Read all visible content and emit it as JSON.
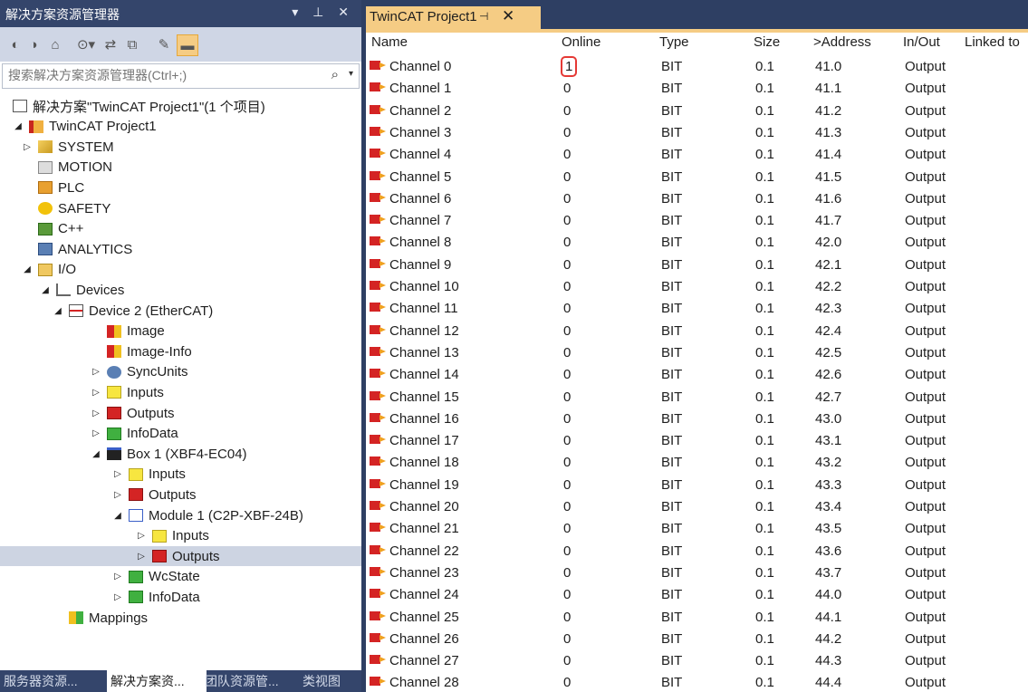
{
  "left_panel": {
    "title": "解决方案资源管理器",
    "title_buttons": "▾ ⊥ ✕",
    "search": {
      "placeholder": "搜索解决方案资源管理器(Ctrl+;)",
      "value": ""
    },
    "tree": [
      {
        "label": "解决方案\"TwinCAT Project1\"(1 个项目)",
        "icon": "solution-icon",
        "level": 0,
        "arrow": ""
      },
      {
        "label": "TwinCAT Project1",
        "icon": "project-icon",
        "level": 1,
        "arrow": "◢"
      },
      {
        "label": "SYSTEM",
        "icon": "system-icon",
        "level": 2,
        "arrow": "▷"
      },
      {
        "label": "MOTION",
        "icon": "motion-icon",
        "level": 2,
        "arrow": ""
      },
      {
        "label": "PLC",
        "icon": "plc-icon",
        "level": 2,
        "arrow": ""
      },
      {
        "label": "SAFETY",
        "icon": "safety-icon",
        "level": 2,
        "arrow": ""
      },
      {
        "label": "C++",
        "icon": "cpp-icon",
        "level": 2,
        "arrow": ""
      },
      {
        "label": "ANALYTICS",
        "icon": "analytics-icon",
        "level": 2,
        "arrow": ""
      },
      {
        "label": "I/O",
        "icon": "io-icon",
        "level": 2,
        "arrow": "◢"
      },
      {
        "label": "Devices",
        "icon": "devices-icon",
        "level": 3,
        "arrow": "◢"
      },
      {
        "label": "Device 2 (EtherCAT)",
        "icon": "ethercat-device-icon",
        "level": 4,
        "arrow": "◢"
      },
      {
        "label": "Image",
        "icon": "image-icon",
        "level": 5,
        "arrow": ""
      },
      {
        "label": "Image-Info",
        "icon": "image-info-icon",
        "level": 5,
        "arrow": ""
      },
      {
        "label": "SyncUnits",
        "icon": "syncunits-icon",
        "level": 5,
        "arrow": "▷"
      },
      {
        "label": "Inputs",
        "icon": "inputs-icon",
        "level": 5,
        "arrow": "▷"
      },
      {
        "label": "Outputs",
        "icon": "outputs-icon",
        "level": 5,
        "arrow": "▷"
      },
      {
        "label": "InfoData",
        "icon": "infodata-icon",
        "level": 5,
        "arrow": "▷"
      },
      {
        "label": "Box 1 (XBF4-EC04)",
        "icon": "box-icon",
        "level": 5,
        "arrow": "◢"
      },
      {
        "label": "Inputs",
        "icon": "inputs-icon",
        "level": 6,
        "arrow": "▷"
      },
      {
        "label": "Outputs",
        "icon": "outputs-icon",
        "level": 6,
        "arrow": "▷"
      },
      {
        "label": "Module 1 (C2P-XBF-24B)",
        "icon": "module-icon",
        "level": 6,
        "arrow": "◢"
      },
      {
        "label": "Inputs",
        "icon": "inputs-icon",
        "level": 7,
        "arrow": "▷"
      },
      {
        "label": "Outputs",
        "icon": "outputs-icon",
        "level": 7,
        "arrow": "▷",
        "selected": true
      },
      {
        "label": "WcState",
        "icon": "wcstate-icon",
        "level": 6,
        "arrow": "▷"
      },
      {
        "label": "InfoData",
        "icon": "infodata-icon",
        "level": 6,
        "arrow": "▷"
      },
      {
        "label": "Mappings",
        "icon": "mappings-icon",
        "level": 4,
        "arrow": ""
      }
    ],
    "bottom_tabs": [
      {
        "label": "服务器资源...",
        "active": false
      },
      {
        "label": "解决方案资...",
        "active": true
      },
      {
        "label": "团队资源管...",
        "active": false
      },
      {
        "label": "类视图",
        "active": false
      }
    ]
  },
  "document": {
    "tab_title": "TwinCAT Project1",
    "pin_icon": "⊣",
    "close_icon": "✕",
    "columns": [
      "Name",
      "Online",
      "Type",
      "Size",
      ">Address",
      "In/Out",
      "Linked to"
    ],
    "rows": [
      [
        "Channel 0",
        "1",
        "BIT",
        "0.1",
        "41.0",
        "Output"
      ],
      [
        "Channel 1",
        "0",
        "BIT",
        "0.1",
        "41.1",
        "Output"
      ],
      [
        "Channel 2",
        "0",
        "BIT",
        "0.1",
        "41.2",
        "Output"
      ],
      [
        "Channel 3",
        "0",
        "BIT",
        "0.1",
        "41.3",
        "Output"
      ],
      [
        "Channel 4",
        "0",
        "BIT",
        "0.1",
        "41.4",
        "Output"
      ],
      [
        "Channel 5",
        "0",
        "BIT",
        "0.1",
        "41.5",
        "Output"
      ],
      [
        "Channel 6",
        "0",
        "BIT",
        "0.1",
        "41.6",
        "Output"
      ],
      [
        "Channel 7",
        "0",
        "BIT",
        "0.1",
        "41.7",
        "Output"
      ],
      [
        "Channel 8",
        "0",
        "BIT",
        "0.1",
        "42.0",
        "Output"
      ],
      [
        "Channel 9",
        "0",
        "BIT",
        "0.1",
        "42.1",
        "Output"
      ],
      [
        "Channel 10",
        "0",
        "BIT",
        "0.1",
        "42.2",
        "Output"
      ],
      [
        "Channel 11",
        "0",
        "BIT",
        "0.1",
        "42.3",
        "Output"
      ],
      [
        "Channel 12",
        "0",
        "BIT",
        "0.1",
        "42.4",
        "Output"
      ],
      [
        "Channel 13",
        "0",
        "BIT",
        "0.1",
        "42.5",
        "Output"
      ],
      [
        "Channel 14",
        "0",
        "BIT",
        "0.1",
        "42.6",
        "Output"
      ],
      [
        "Channel 15",
        "0",
        "BIT",
        "0.1",
        "42.7",
        "Output"
      ],
      [
        "Channel 16",
        "0",
        "BIT",
        "0.1",
        "43.0",
        "Output"
      ],
      [
        "Channel 17",
        "0",
        "BIT",
        "0.1",
        "43.1",
        "Output"
      ],
      [
        "Channel 18",
        "0",
        "BIT",
        "0.1",
        "43.2",
        "Output"
      ],
      [
        "Channel 19",
        "0",
        "BIT",
        "0.1",
        "43.3",
        "Output"
      ],
      [
        "Channel 20",
        "0",
        "BIT",
        "0.1",
        "43.4",
        "Output"
      ],
      [
        "Channel 21",
        "0",
        "BIT",
        "0.1",
        "43.5",
        "Output"
      ],
      [
        "Channel 22",
        "0",
        "BIT",
        "0.1",
        "43.6",
        "Output"
      ],
      [
        "Channel 23",
        "0",
        "BIT",
        "0.1",
        "43.7",
        "Output"
      ],
      [
        "Channel 24",
        "0",
        "BIT",
        "0.1",
        "44.0",
        "Output"
      ],
      [
        "Channel 25",
        "0",
        "BIT",
        "0.1",
        "44.1",
        "Output"
      ],
      [
        "Channel 26",
        "0",
        "BIT",
        "0.1",
        "44.2",
        "Output"
      ],
      [
        "Channel 27",
        "0",
        "BIT",
        "0.1",
        "44.3",
        "Output"
      ],
      [
        "Channel 28",
        "0",
        "BIT",
        "0.1",
        "44.4",
        "Output"
      ]
    ],
    "highlight": "Channel 0 Online"
  },
  "colors": {
    "title_bar": "#34456b",
    "toolbar": "#cfd6e5",
    "doc_tab": "#f5cc84",
    "selection": "#cdd4e2",
    "highlight_box": "#e53935"
  }
}
